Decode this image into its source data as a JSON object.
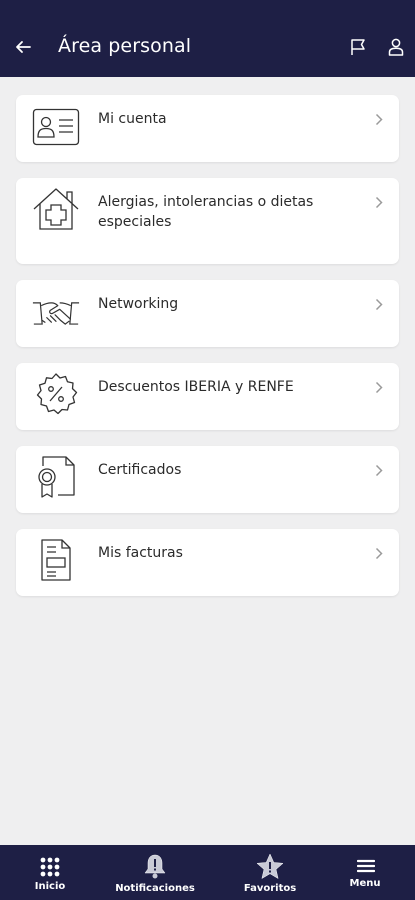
{
  "header": {
    "title": "Área personal",
    "back_icon": "arrow-left-icon",
    "flag_icon": "flag-icon",
    "user_icon": "user-icon"
  },
  "menu": {
    "items": [
      {
        "label": "Mi cuenta",
        "icon": "id-card-icon"
      },
      {
        "label": "Alergias, intolerancias o dietas especiales",
        "icon": "medical-house-icon"
      },
      {
        "label": "Networking",
        "icon": "handshake-icon"
      },
      {
        "label": "Descuentos IBERIA y RENFE",
        "icon": "discount-badge-icon"
      },
      {
        "label": "Certificados",
        "icon": "certificate-icon"
      },
      {
        "label": "Mis facturas",
        "icon": "invoice-icon"
      }
    ]
  },
  "bottom_nav": {
    "items": [
      {
        "label": "Inicio",
        "icon": "grid-icon"
      },
      {
        "label": "Notificaciones",
        "icon": "bell-icon"
      },
      {
        "label": "Favoritos",
        "icon": "star-icon"
      },
      {
        "label": "Menu",
        "icon": "hamburger-icon"
      }
    ]
  },
  "colors": {
    "header_bg": "#1e1f45",
    "page_bg": "#efeff0",
    "card_bg": "#ffffff"
  }
}
